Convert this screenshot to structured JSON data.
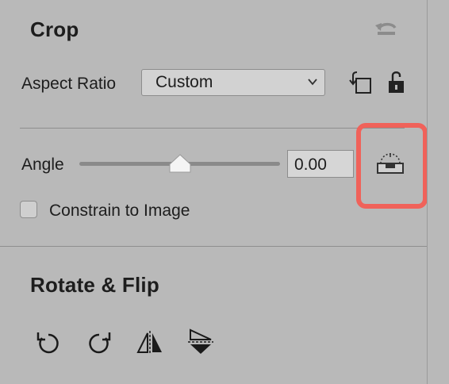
{
  "crop": {
    "title": "Crop",
    "aspect_ratio_label": "Aspect Ratio",
    "aspect_ratio_value": "Custom",
    "angle_label": "Angle",
    "angle_value": "0.00",
    "angle_slider_position": 0.5,
    "constrain_label": "Constrain to Image",
    "constrain_checked": false
  },
  "rotate_flip": {
    "title": "Rotate & Flip"
  },
  "icons": {
    "reset": "reset-arrow-icon",
    "rotate_crop": "rotate-crop-orientation-icon",
    "lock": "unlocked-padlock-icon",
    "straighten": "level-straighten-icon",
    "rotate_left": "rotate-counterclockwise-icon",
    "rotate_right": "rotate-clockwise-icon",
    "flip_horizontal": "flip-horizontal-icon",
    "flip_vertical": "flip-vertical-icon"
  },
  "colors": {
    "panel_bg": "#b9b9b9",
    "highlight": "#f0625a"
  }
}
